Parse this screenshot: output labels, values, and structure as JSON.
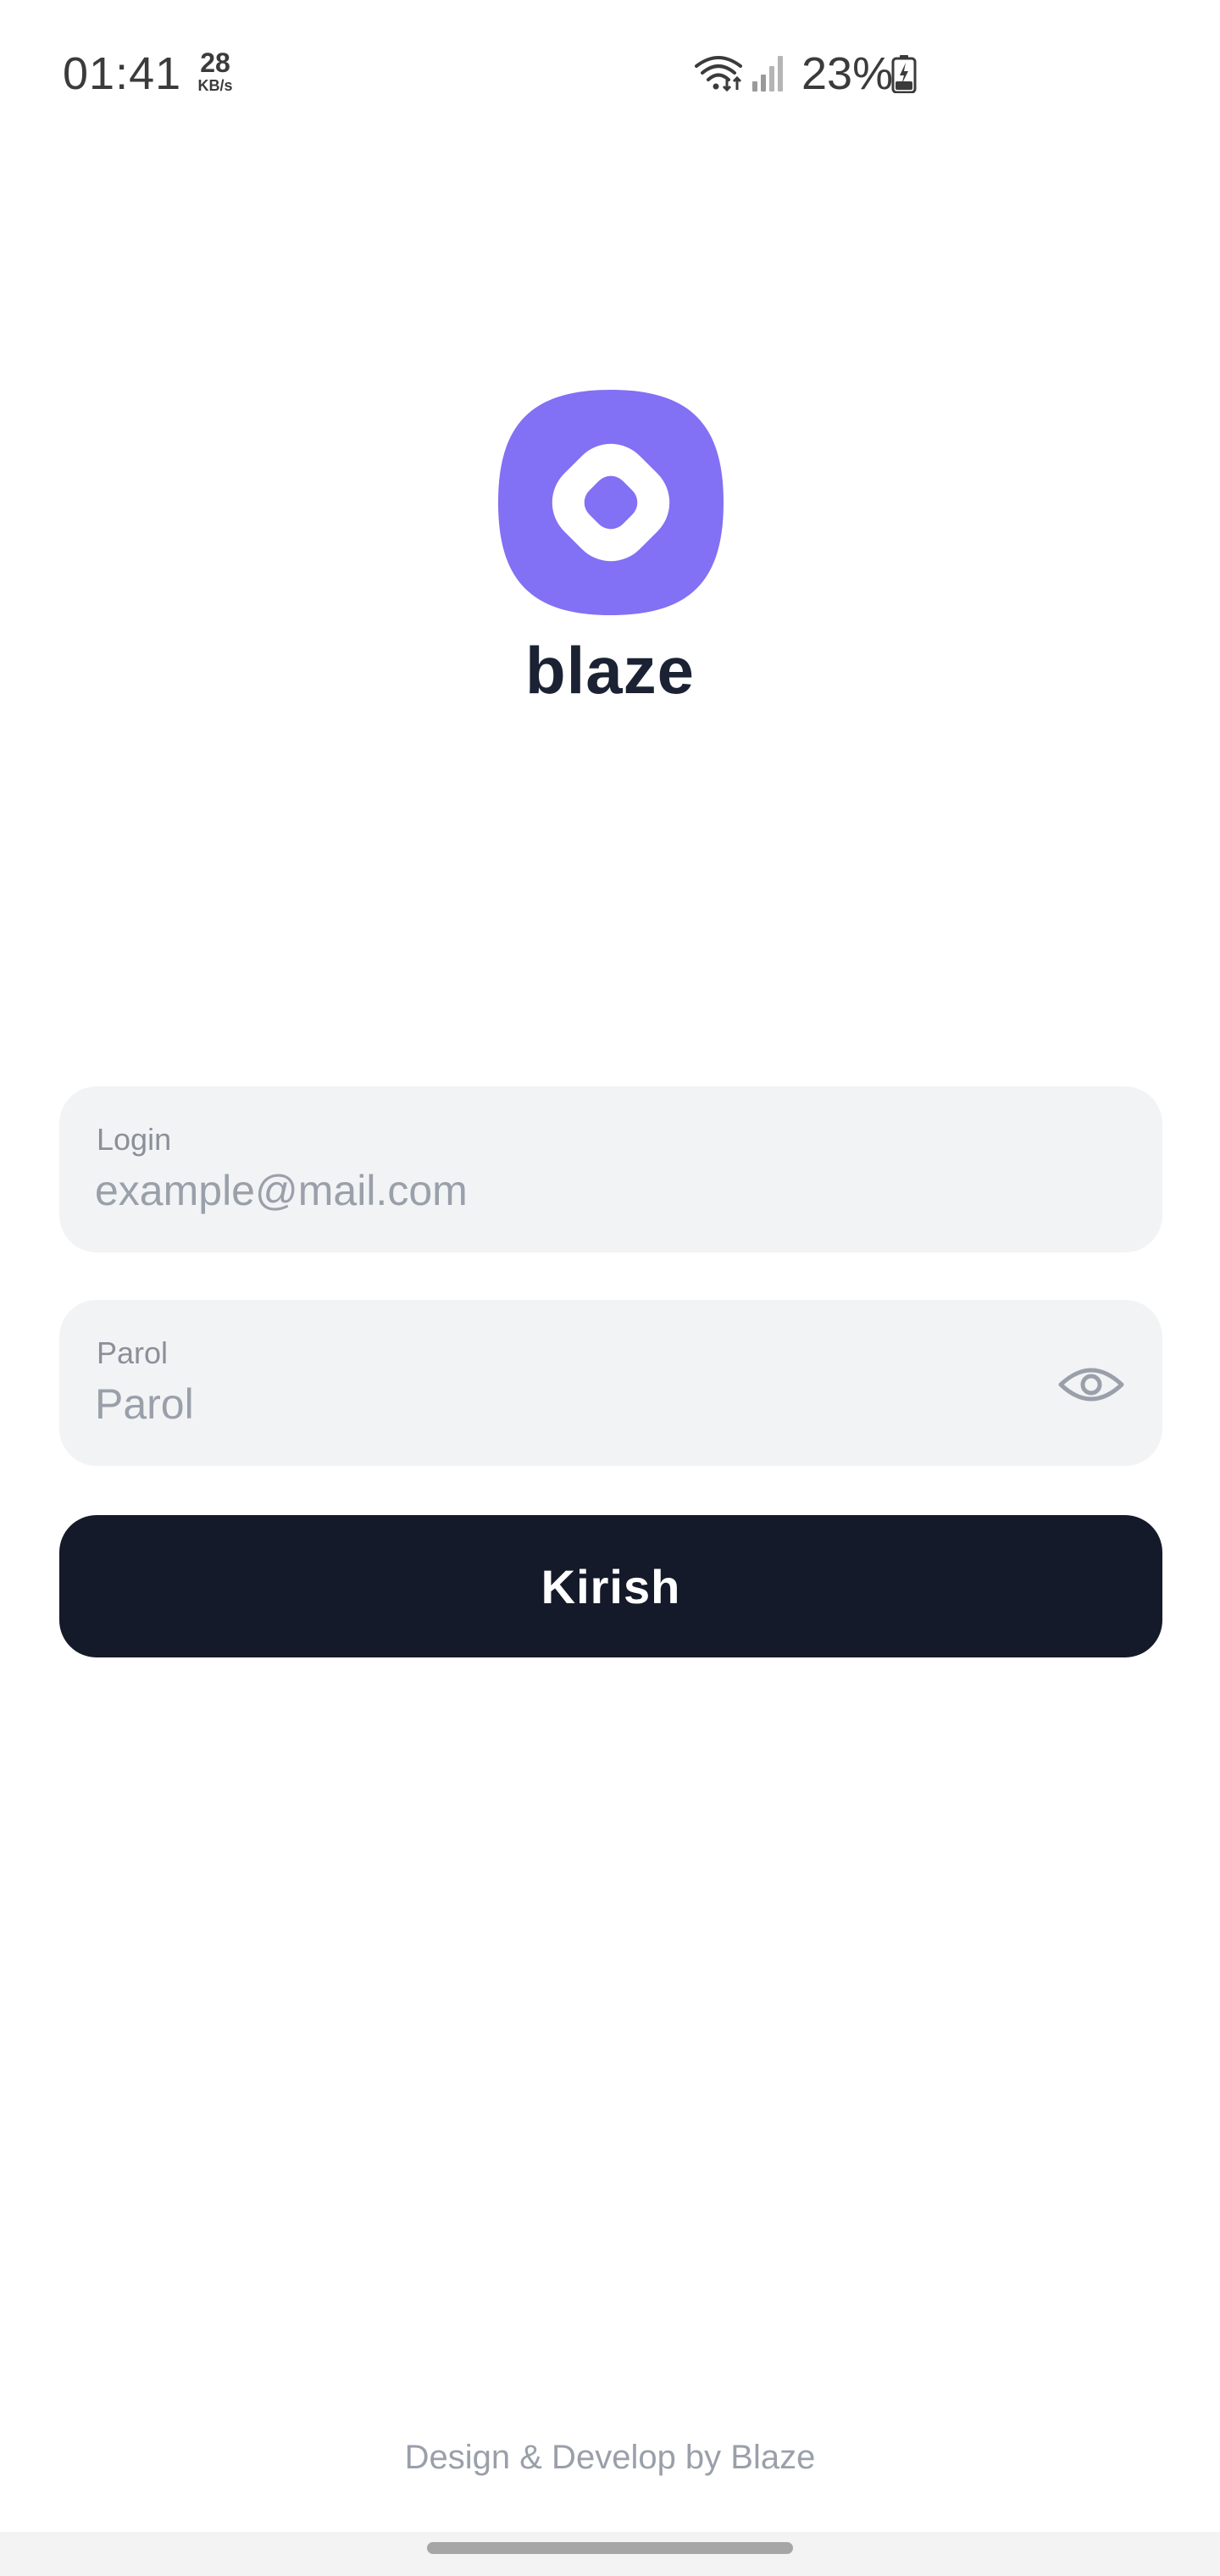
{
  "status_bar": {
    "time": "01:41",
    "net_speed_value": "28",
    "net_speed_unit": "KB/s",
    "battery_percent": "23%",
    "icons": [
      "wifi-icon",
      "signal-icon",
      "battery-charging-icon"
    ]
  },
  "brand": {
    "name": "blaze",
    "logo_icon": "blaze-logo-icon",
    "logo_color": "#8270f5"
  },
  "login_form": {
    "login_label": "Login",
    "login_placeholder": "example@mail.com",
    "login_value": "",
    "password_label": "Parol",
    "password_placeholder": "Parol",
    "password_value": "",
    "password_toggle_icon": "eye-icon",
    "submit_label": "Kirish"
  },
  "footer": {
    "credit": "Design & Develop by Blaze"
  },
  "colors": {
    "button_bg": "#141a29",
    "field_bg": "#f2f3f5",
    "brand_text": "#1a2233"
  }
}
